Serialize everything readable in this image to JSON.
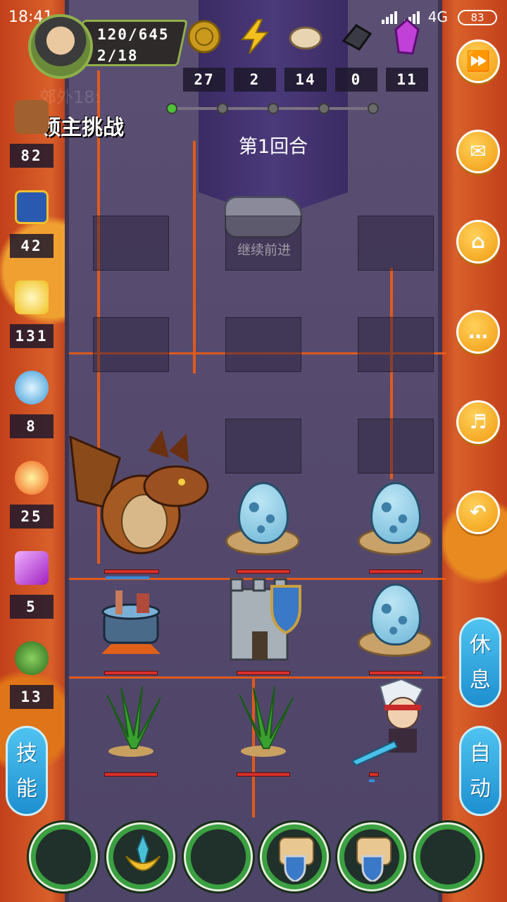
{
  "status_bar": {
    "time": "18:41",
    "network": "4G",
    "battery": "83"
  },
  "player": {
    "xp": "120/645",
    "level": "2/18"
  },
  "resources": [
    {
      "icon": "coin-icon",
      "value": "27"
    },
    {
      "icon": "lightning-energy-icon",
      "value": "2"
    },
    {
      "icon": "bread-food-icon",
      "value": "14"
    },
    {
      "icon": "iron-ore-icon",
      "value": "0"
    },
    {
      "icon": "crystal-gem-icon",
      "value": "11"
    }
  ],
  "stage": {
    "dungeon_name": "郊外18:",
    "mode": "领主挑战",
    "round": "第1回合",
    "continue_label": "继续前进",
    "progress_total": 5,
    "progress_done": 1
  },
  "stats": [
    {
      "icon": "fist-attack-icon",
      "value": "82"
    },
    {
      "icon": "shield-defense-icon",
      "value": "42"
    },
    {
      "icon": "holy-light-icon",
      "value": "131"
    },
    {
      "icon": "water-wave-icon",
      "value": "8"
    },
    {
      "icon": "fireball-icon",
      "value": "25"
    },
    {
      "icon": "lightning-shock-icon",
      "value": "5"
    },
    {
      "icon": "poison-snake-icon",
      "value": "13"
    }
  ],
  "side_buttons": [
    {
      "name": "fast-forward-button",
      "icon": "fast-forward-icon"
    },
    {
      "name": "mail-button",
      "icon": "envelope-icon"
    },
    {
      "name": "home-button",
      "icon": "home-icon"
    },
    {
      "name": "chat-button",
      "icon": "chat-bubble-icon"
    },
    {
      "name": "sound-button",
      "icon": "speaker-icon"
    },
    {
      "name": "undo-button",
      "icon": "undo-arrow-icon"
    }
  ],
  "buttons": {
    "rest": [
      "休",
      "息"
    ],
    "auto": [
      "自",
      "动"
    ],
    "skills": [
      "技",
      "能"
    ]
  },
  "skill_slots": [
    {
      "icon": "empty-slot-icon"
    },
    {
      "icon": "sword-emblem-icon"
    },
    {
      "icon": "empty-slot-icon"
    },
    {
      "icon": "scroll-shield-icon"
    },
    {
      "icon": "scroll-shield-icon"
    },
    {
      "icon": "empty-slot-icon"
    }
  ],
  "colors": {
    "accent_orange": "#f29a10",
    "accent_blue": "#1e8fd0",
    "hp_red": "#d8302a",
    "lava": "#c2401a"
  }
}
